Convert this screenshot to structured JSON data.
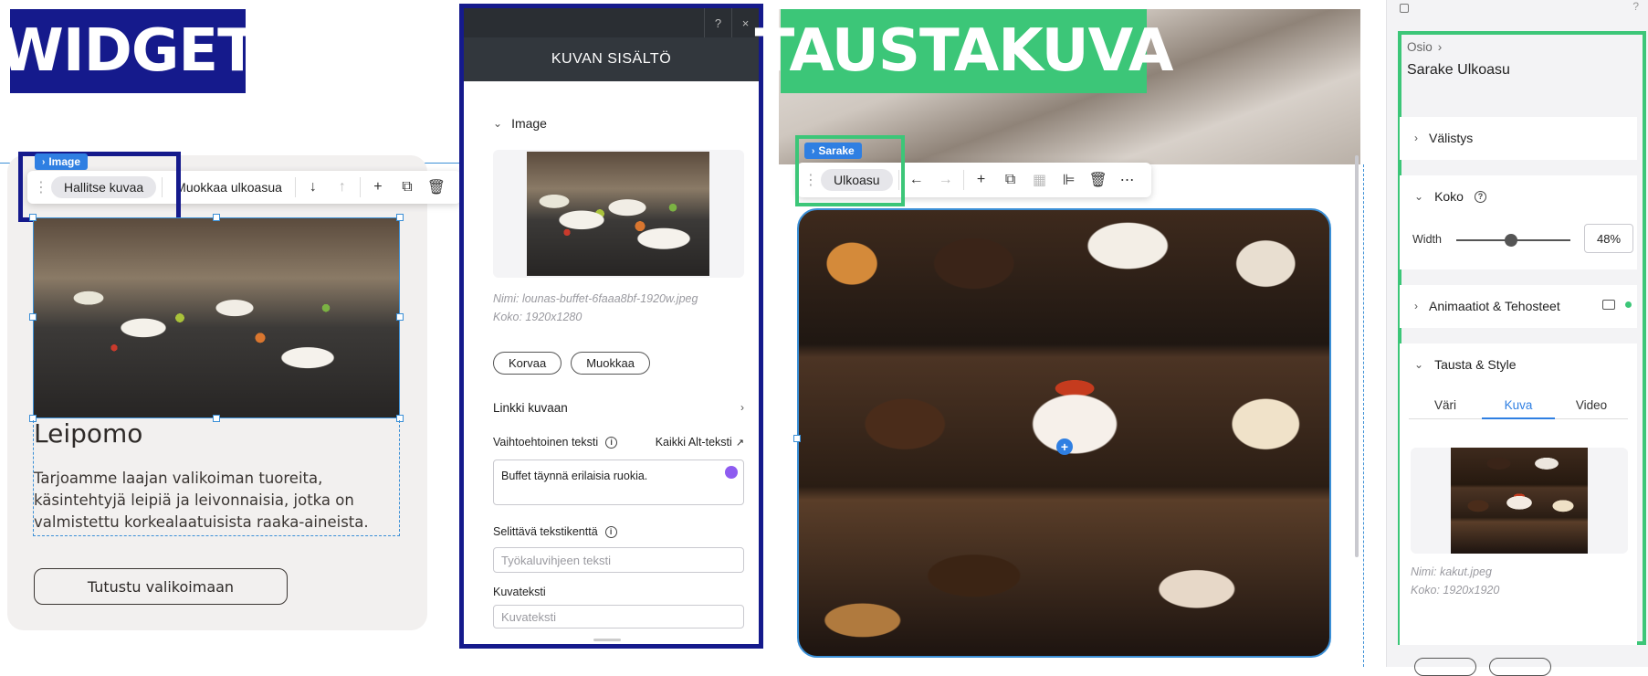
{
  "left": {
    "banner": "WIDGET",
    "tag": "Image",
    "toolbar": {
      "manage": "Hallitse kuvaa",
      "edit_layout": "Muokkaa ulkoasua"
    },
    "heading": "Leipomo",
    "body": "Tarjoamme laajan valikoiman tuoreita, käsintehtyjä leipiä ja leivonnaisia, jotka on valmistettu korkealaatuisista raaka-aineista.",
    "cta": "Tutustu valikoimaan"
  },
  "dialog": {
    "help": "?",
    "close": "×",
    "title": "KUVAN SISÄLTÖ",
    "section": "Image",
    "name_line": "Nimi: lounas-buffet-6faaa8bf-1920w.jpeg",
    "size_line": "Koko: 1920x1280",
    "replace": "Korvaa",
    "edit": "Muokkaa",
    "link_label": "Linkki kuvaan",
    "alt_label": "Vaihtoehtoinen teksti",
    "all_alt": "Kaikki Alt-teksti",
    "alt_value": "Buffet täynnä erilaisia ruokia.",
    "tooltip_label": "Selittävä tekstikenttä",
    "tooltip_placeholder": "Työkaluvihjeen teksti",
    "caption_label": "Kuvateksti",
    "caption_placeholder": "Kuvateksti"
  },
  "center": {
    "banner": "TAUSTAKUVA",
    "tag": "Sarake",
    "toolbar_pill": "Ulkoasu"
  },
  "panel": {
    "breadcrumb": "Osio",
    "title": "Sarake Ulkoasu",
    "spacing": "Välistys",
    "size": "Koko",
    "width_label": "Width",
    "width_value": "48%",
    "width_fraction": 0.48,
    "animations": "Animaatiot & Tehosteet",
    "background": "Tausta & Style",
    "tabs": [
      "Väri",
      "Kuva",
      "Video"
    ],
    "active_tab": "Kuva",
    "name_line": "Nimi: kakut.jpeg",
    "size_line": "Koko: 1920x1920"
  },
  "colors": {
    "widget_blue": "#151a8c",
    "background_green": "#3cc678",
    "selection_blue": "#3b8fd6",
    "accent_blue": "#2f7fe2"
  }
}
